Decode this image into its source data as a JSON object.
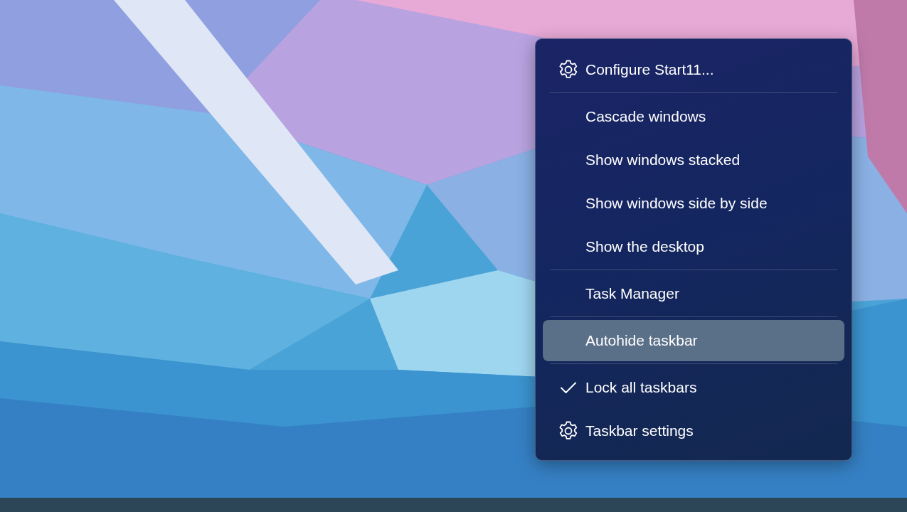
{
  "context_menu": {
    "items": [
      {
        "kind": "settings_item",
        "label": "Configure Start11...",
        "checked": false,
        "selected": false
      },
      {
        "kind": "separator"
      },
      {
        "kind": "item",
        "label": "Cascade windows",
        "checked": false,
        "selected": false
      },
      {
        "kind": "item",
        "label": "Show windows stacked",
        "checked": false,
        "selected": false
      },
      {
        "kind": "item",
        "label": "Show windows side by side",
        "checked": false,
        "selected": false
      },
      {
        "kind": "item",
        "label": "Show the desktop",
        "checked": false,
        "selected": false
      },
      {
        "kind": "separator"
      },
      {
        "kind": "item",
        "label": "Task Manager",
        "checked": false,
        "selected": false
      },
      {
        "kind": "separator"
      },
      {
        "kind": "item",
        "label": "Autohide taskbar",
        "checked": false,
        "selected": true
      },
      {
        "kind": "separator"
      },
      {
        "kind": "item",
        "label": "Lock all taskbars",
        "checked": true,
        "selected": false
      },
      {
        "kind": "settings_item",
        "label": "Taskbar settings",
        "checked": false,
        "selected": false
      }
    ]
  }
}
